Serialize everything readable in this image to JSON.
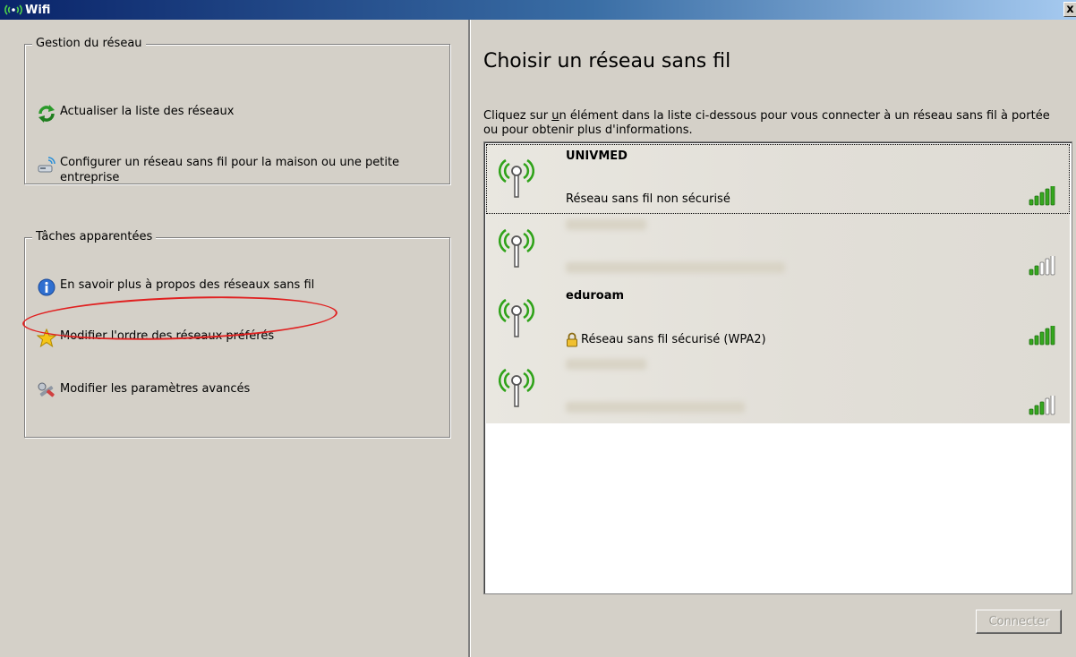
{
  "window": {
    "title": "Wifi",
    "close_label": "x"
  },
  "left": {
    "group1": {
      "legend": "Gestion du réseau",
      "items": [
        {
          "label": "Actualiser la liste des réseaux",
          "icon": "refresh-icon"
        },
        {
          "label": "Configurer un réseau sans fil pour la maison ou une petite entreprise",
          "icon": "network-setup-icon"
        }
      ]
    },
    "group2": {
      "legend": "Tâches apparentées",
      "items": [
        {
          "label": "En savoir plus à propos des réseaux sans fil",
          "icon": "info-icon"
        },
        {
          "label": "Modifier l'ordre des réseaux préférés",
          "icon": "star-icon"
        },
        {
          "label": "Modifier les paramètres avancés",
          "icon": "settings-tools-icon"
        }
      ]
    }
  },
  "right": {
    "heading": "Choisir un réseau sans fil",
    "instructions_pre": "Cliquez sur ",
    "instructions_u": "u",
    "instructions_post": "n élément dans la liste ci-dessous pour vous connecter à un réseau sans fil à portée ou pour obtenir plus d'informations.",
    "networks": [
      {
        "ssid": "UNIVMED",
        "security": "Réseau sans fil non sécurisé",
        "signal_bars": 5,
        "secured": false,
        "selected": true
      },
      {
        "ssid": "",
        "security": "",
        "signal_bars": 2,
        "secured": true,
        "hidden": true
      },
      {
        "ssid": "eduroam",
        "security": "Réseau sans fil sécurisé (WPA2)",
        "signal_bars": 5,
        "secured": true
      },
      {
        "ssid": "",
        "security": "",
        "signal_bars": 3,
        "secured": true,
        "hidden": true
      }
    ],
    "connect_button": "Connecter"
  },
  "colors": {
    "signal_on": "#35a81e",
    "signal_off": "#ffffff",
    "antenna": "#2fa319",
    "annotation": "#e02020"
  }
}
